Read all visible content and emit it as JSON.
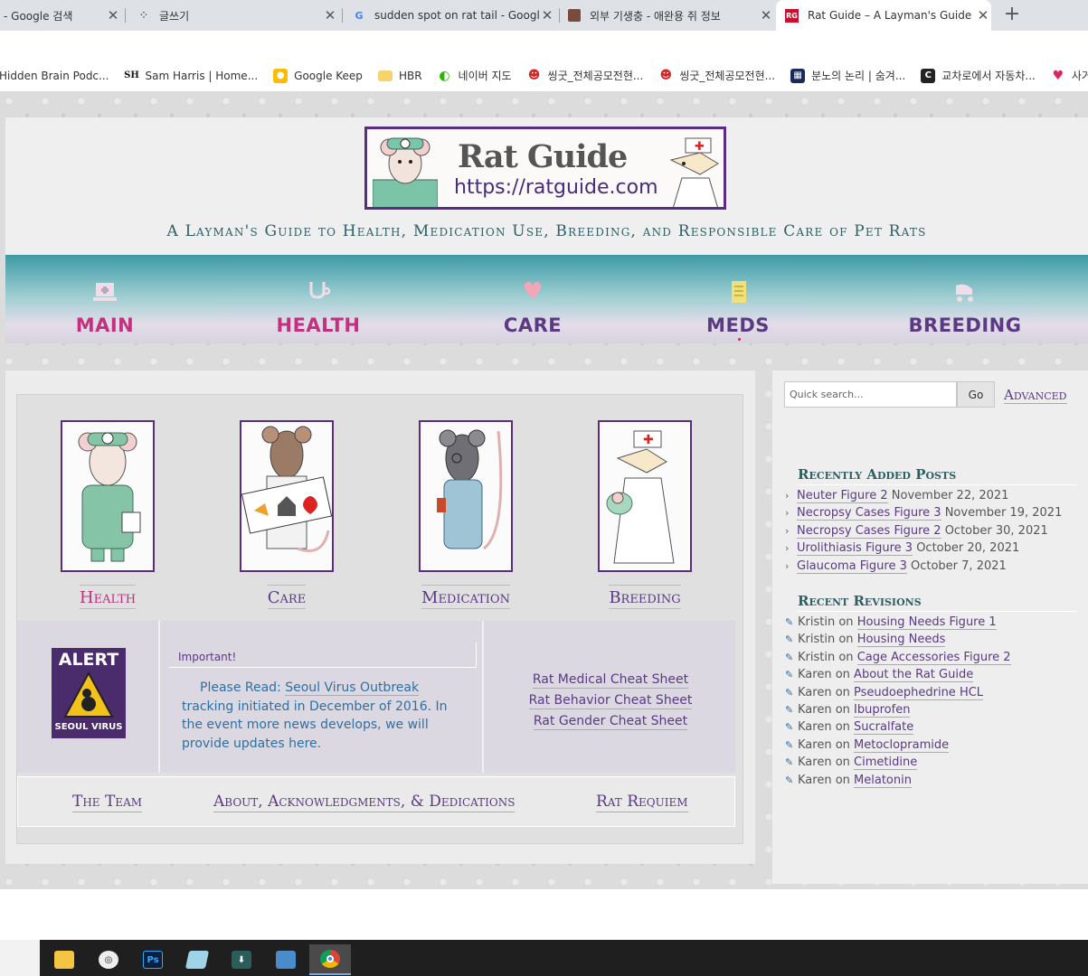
{
  "browser": {
    "tabs": [
      {
        "title": "- Google 검색",
        "icon": "google-icon"
      },
      {
        "title": "글쓰기",
        "icon": "dots-icon"
      },
      {
        "title": "sudden spot on rat tail - Googl",
        "icon": "google-icon"
      },
      {
        "title": "외부 기생충 - 애완용 쥐 정보",
        "icon": "photo-icon"
      },
      {
        "title": "Rat Guide – A Layman's Guide t",
        "icon": "ratguide-icon",
        "active": true
      }
    ],
    "favicon_text": "RG",
    "bookmarks": [
      {
        "label": "Hidden Brain Podc...",
        "icon": ""
      },
      {
        "label": "Sam Harris | Home...",
        "icon": "SH"
      },
      {
        "label": "Google Keep",
        "icon": "keep-icon"
      },
      {
        "label": "HBR",
        "icon": "folder-icon"
      },
      {
        "label": "네이버 지도",
        "icon": "map-icon"
      },
      {
        "label": "씽굿_전체공모전현...",
        "icon": "smile-icon"
      },
      {
        "label": "씽굿_전체공모전현...",
        "icon": "smile-icon"
      },
      {
        "label": "분노의 논리 | 숨겨...",
        "icon": "grid-icon"
      },
      {
        "label": "교차로에서 자동차...",
        "icon": "c-icon"
      },
      {
        "label": "사거",
        "icon": "heart-icon"
      }
    ],
    "bookmark_letters": {
      "sh": "SH",
      "c": "C"
    }
  },
  "site": {
    "logo_title": "Rat Guide",
    "logo_url": "https://ratguide.com",
    "tagline": "A Layman's Guide to Health, Medication Use, Breeding, and Responsible Care of Pet Rats",
    "nav": [
      {
        "label": "MAIN",
        "icon": "laptop-icon",
        "color": "#c2307e"
      },
      {
        "label": "HEALTH",
        "icon": "stethoscope-icon",
        "color": "#c2307e"
      },
      {
        "label": "CARE",
        "icon": "heart-icon",
        "color": "#5a3a82"
      },
      {
        "label": "MEDS",
        "icon": "clipboard-icon",
        "color": "#5a3a82"
      },
      {
        "label": "BREEDING",
        "icon": "stroller-icon",
        "color": "#5a3a82"
      }
    ],
    "cards": [
      {
        "label": "Health",
        "image": "rat-doctor"
      },
      {
        "label": "Care",
        "image": "rat-care"
      },
      {
        "label": "Medication",
        "image": "rat-medication"
      },
      {
        "label": "Breeding",
        "image": "rat-nurse"
      }
    ],
    "alert": {
      "badge_top": "ALERT",
      "badge_bottom": "SEOUL VIRUS",
      "heading": "Important!",
      "text_prefix": "Please Read: ",
      "link": "Seoul Virus Outbreak",
      "text_suffix": " tracking initiated in December of 2016. In the event more news develops, we will provide updates here."
    },
    "cheatsheets": [
      "Rat Medical Cheat Sheet",
      "Rat Behavior Cheat Sheet",
      "Rat Gender Cheat Sheet"
    ],
    "footer_links": [
      "The Team",
      "About, Acknowledgments, & Dedications",
      "Rat Requiem"
    ]
  },
  "sidebar": {
    "search_placeholder": "Quick search...",
    "go_label": "Go",
    "advanced_label": "Advanced",
    "recent_posts_heading": "Recently Added Posts",
    "recent_posts": [
      {
        "title": "Neuter Figure 2",
        "date": "November 22, 2021"
      },
      {
        "title": "Necropsy Cases Figure 3",
        "date": "November 19, 2021"
      },
      {
        "title": "Necropsy Cases Figure 2",
        "date": "October 30, 2021"
      },
      {
        "title": "Urolithiasis Figure 3",
        "date": "October 20, 2021"
      },
      {
        "title": "Glaucoma Figure 3",
        "date": "October 7, 2021"
      }
    ],
    "recent_revisions_heading": "Recent Revisions",
    "revisions": [
      {
        "author": "Kristin",
        "page": "Housing Needs Figure 1"
      },
      {
        "author": "Kristin",
        "page": "Housing Needs"
      },
      {
        "author": "Kristin",
        "page": "Cage Accessories Figure 2"
      },
      {
        "author": "Karen",
        "page": "About the Rat Guide"
      },
      {
        "author": "Karen",
        "page": "Pseudoephedrine HCL"
      },
      {
        "author": "Karen",
        "page": "Ibuprofen"
      },
      {
        "author": "Karen",
        "page": "Sucralfate"
      },
      {
        "author": "Karen",
        "page": "Metoclopramide"
      },
      {
        "author": "Karen",
        "page": "Cimetidine"
      },
      {
        "author": "Karen",
        "page": "Melatonin"
      }
    ],
    "on_word": "on"
  },
  "taskbar": {
    "apps": [
      "file-explorer-icon",
      "swirl-app-icon",
      "photoshop-icon",
      "notes-app-icon",
      "installer-icon",
      "photos-icon",
      "chrome-icon"
    ],
    "ps_label": "Ps"
  }
}
